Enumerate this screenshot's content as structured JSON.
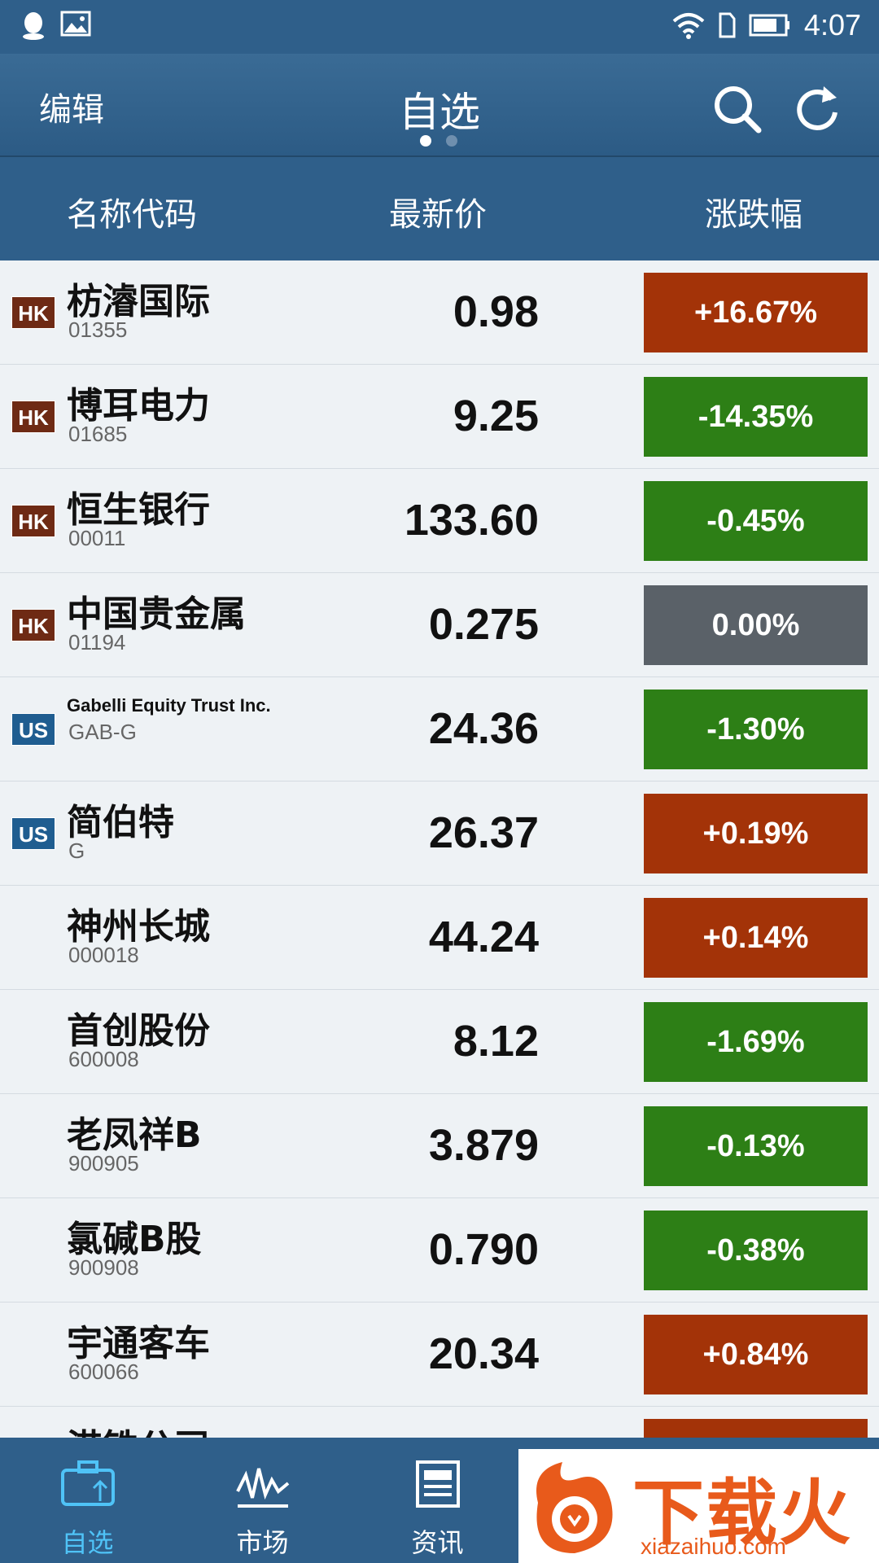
{
  "status_bar": {
    "time": "4:07",
    "icons": [
      "qq-icon",
      "gallery-icon",
      "wifi-icon",
      "sim-icon",
      "battery-icon"
    ]
  },
  "header": {
    "edit_label": "编辑",
    "title": "自选",
    "page_dots": 2,
    "active_dot": 0
  },
  "columns": {
    "name": "名称代码",
    "price": "最新价",
    "change": "涨跌幅"
  },
  "colors": {
    "up": "#a33308",
    "down": "#2d7f16",
    "flat": "#5a6168",
    "header_bg": "#2f5f8a",
    "active_tab": "#4fc3f7"
  },
  "stocks": [
    {
      "market": "HK",
      "name": "枋濬国际",
      "code": "01355",
      "price": "0.98",
      "change": "+16.67%",
      "dir": "up"
    },
    {
      "market": "HK",
      "name": "博耳电力",
      "code": "01685",
      "price": "9.25",
      "change": "-14.35%",
      "dir": "down"
    },
    {
      "market": "HK",
      "name": "恒生银行",
      "code": "00011",
      "price": "133.60",
      "change": "-0.45%",
      "dir": "down"
    },
    {
      "market": "HK",
      "name": "中国贵金属",
      "code": "01194",
      "price": "0.275",
      "change": "0.00%",
      "dir": "flat"
    },
    {
      "market": "US",
      "name": "Gabelli Equity Trust Inc.",
      "code": "GAB-G",
      "price": "24.36",
      "change": "-1.30%",
      "dir": "down",
      "small_name": true
    },
    {
      "market": "US",
      "name": "简伯特",
      "code": "G",
      "price": "26.37",
      "change": "+0.19%",
      "dir": "up"
    },
    {
      "market": "",
      "name": "神州长城",
      "code": "000018",
      "price": "44.24",
      "change": "+0.14%",
      "dir": "up"
    },
    {
      "market": "",
      "name": "首创股份",
      "code": "600008",
      "price": "8.12",
      "change": "-1.69%",
      "dir": "down"
    },
    {
      "market": "",
      "name": "老凤祥B",
      "code": "900905",
      "price": "3.879",
      "change": "-0.13%",
      "dir": "down"
    },
    {
      "market": "",
      "name": "氯碱B股",
      "code": "900908",
      "price": "0.790",
      "change": "-0.38%",
      "dir": "down"
    },
    {
      "market": "",
      "name": "宇通客车",
      "code": "600066",
      "price": "20.34",
      "change": "+0.84%",
      "dir": "up"
    },
    {
      "market": "",
      "name": "港铁公司",
      "code": "",
      "price": "",
      "change": "",
      "dir": "up"
    }
  ],
  "tabs": [
    {
      "label": "自选",
      "icon": "briefcase-icon",
      "active": true
    },
    {
      "label": "市场",
      "icon": "chart-line-icon",
      "active": false
    },
    {
      "label": "资讯",
      "icon": "newspaper-icon",
      "active": false
    }
  ],
  "ad": {
    "text": "下载火",
    "url_text": "xiazaihuo.com"
  }
}
